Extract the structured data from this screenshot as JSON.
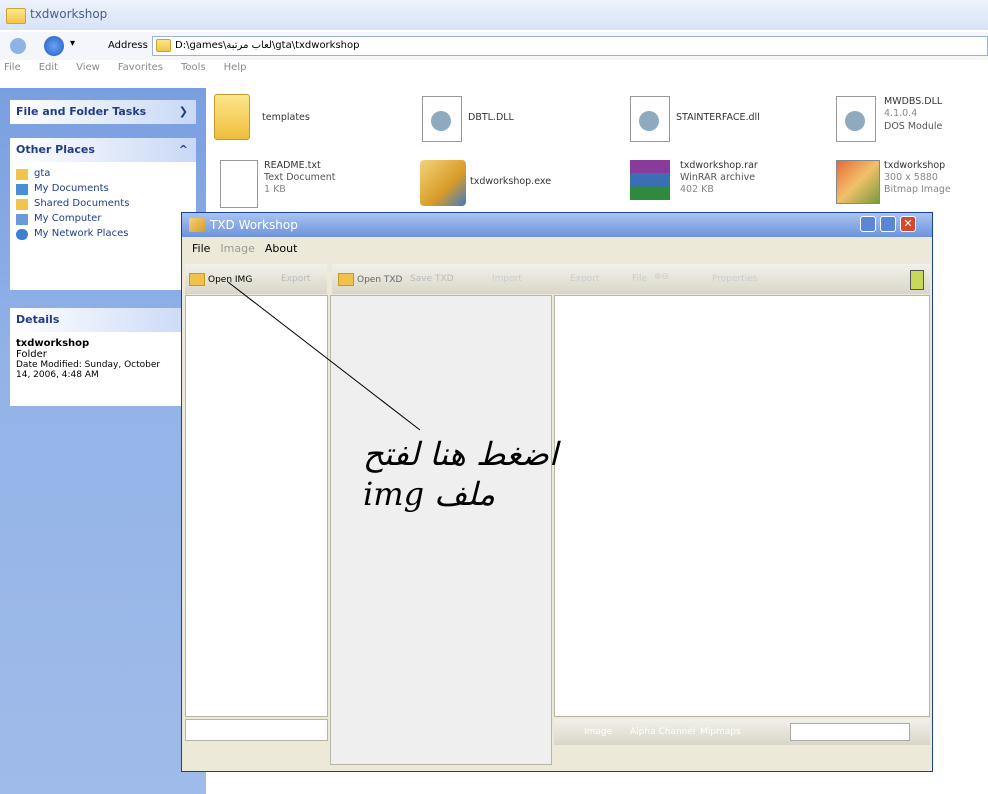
{
  "explorer": {
    "title": "txdworkshop",
    "address_label": "Address",
    "address_value": "D:\\games\\لعاب مرتبة\\gta\\txdworkshop",
    "menu": [
      "File",
      "Edit",
      "View",
      "Favorites",
      "Tools",
      "Help"
    ],
    "tasks": {
      "file_folder_header": "File and Folder Tasks",
      "other_places_header": "Other Places",
      "other_places": [
        "gta",
        "My Documents",
        "Shared Documents",
        "My Computer",
        "My Network Places"
      ],
      "details_header": "Details",
      "details_name": "txdworkshop",
      "details_type": "Folder",
      "details_modified": "Date Modified: Sunday, October",
      "details_modified_2": "14, 2006, 4:48 AM"
    },
    "files": [
      {
        "name": "templates",
        "sub1": "",
        "sub2": "",
        "icon": "folder-icon"
      },
      {
        "name": "DBTL.DLL",
        "sub1": "",
        "sub2": "",
        "icon": "dll-gear-icon"
      },
      {
        "name": "STAINTERFACE.dll",
        "sub1": "",
        "sub2": "",
        "icon": "dll-gear-icon"
      },
      {
        "name": "MWDBS.DLL",
        "sub1": "4.1.0.4",
        "sub2": "DOS Module",
        "icon": "dll-gear-icon"
      },
      {
        "name": "README.txt",
        "sub1": "Text Document",
        "sub2": "1 KB",
        "icon": "text-document-icon"
      },
      {
        "name": "txdworkshop.exe",
        "sub1": "",
        "sub2": "",
        "icon": "exe-icon"
      },
      {
        "name": "txdworkshop.rar",
        "sub1": "WinRAR archive",
        "sub2": "402 KB",
        "icon": "winrar-icon"
      },
      {
        "name": "txdworkshop",
        "sub1": "300 x 5880",
        "sub2": "Bitmap Image",
        "icon": "bitmap-icon"
      }
    ]
  },
  "txd": {
    "title": "TXD Workshop",
    "menu": [
      "File",
      "Image",
      "About"
    ],
    "toolbar_left": [
      "Open IMG",
      "Export"
    ],
    "toolbar_main": [
      "Open TXD",
      "Save TXD",
      "Import",
      "Export",
      "File",
      "Properties"
    ],
    "bottom_toolbar": [
      "Image",
      "Alpha Channel",
      "Mipmaps"
    ]
  },
  "annotation": {
    "line1": "اضغط هنا لفتح",
    "line2": "ملف img"
  }
}
